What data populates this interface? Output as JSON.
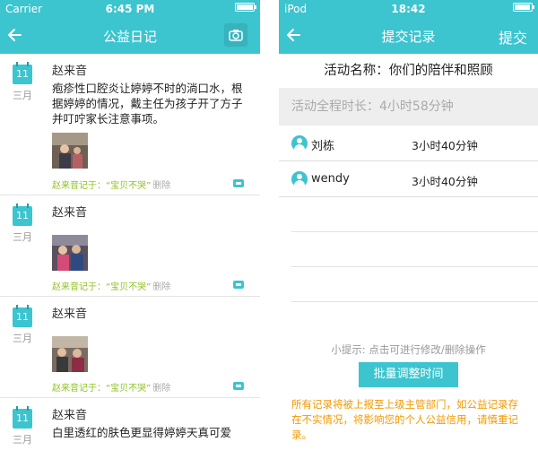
{
  "left_screen": {
    "status": {
      "carrier": "Carrier",
      "time": "6:45 PM",
      "battery_level": 0.95
    },
    "title": "公益日记",
    "entries": [
      {
        "day": "11",
        "month": "三月",
        "author": "赵来音",
        "content": "疱疹性口腔炎让婷婷不时的淌口水，根据婷婷的情况，戴主任为孩子开了方子并叮咛家长注意事项。",
        "footer": "赵来音记于：“宝贝不哭”",
        "delete": "删除"
      },
      {
        "day": "11",
        "month": "三月",
        "author": "赵来音",
        "content": "",
        "footer": "赵来音记于：“宝贝不哭”",
        "delete": "删除"
      },
      {
        "day": "11",
        "month": "三月",
        "author": "赵来音",
        "content": "",
        "footer": "赵来音记于：“宝贝不哭”",
        "delete": "删除"
      },
      {
        "day": "11",
        "month": "三月",
        "author": "赵来音",
        "content": "白里透红的肤色更显得婷婷天真可爱",
        "footer": "",
        "delete": ""
      }
    ]
  },
  "right_screen": {
    "status": {
      "carrier": "iPod",
      "time": "18:42",
      "battery_level": 0.9
    },
    "title": "提交记录",
    "action": "提交",
    "activity_name": "活动名称：你们的陪伴和照顾",
    "total_duration": "活动全程时长：4小时58分钟",
    "records": [
      {
        "name": "刘栋",
        "duration": "3小时40分钟"
      },
      {
        "name": "wendy",
        "duration": "3小时40分钟"
      }
    ],
    "hint": "小提示: 点击可进行修改/删除操作",
    "batch_button": "批量调整时间",
    "warning": "所有记录将被上报至上级主管部门，如公益记录存在不实情况，将影响您的个人公益信用，请慎重记录。"
  },
  "colors": {
    "accent": "#3cc4cf",
    "note_green": "#8fc31f",
    "warning_orange": "#f39800"
  }
}
